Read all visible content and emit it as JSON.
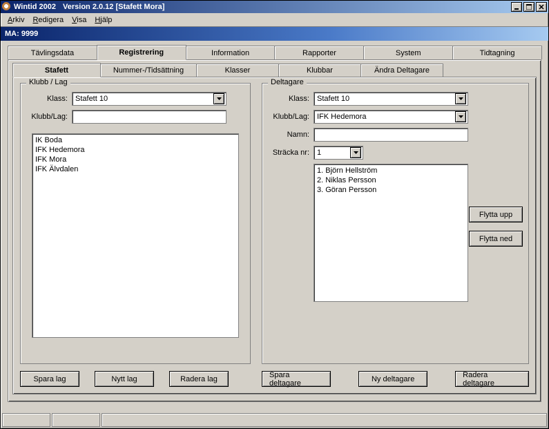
{
  "window": {
    "title_app": "Wintid 2002",
    "title_version": "Version 2.0.12 [Stafett Mora]"
  },
  "menu": {
    "arkiv": "Arkiv",
    "redigera": "Redigera",
    "visa": "Visa",
    "help": "Hjälp"
  },
  "infobar": {
    "text": "MA: 9999"
  },
  "main_tabs": {
    "tavlingsdata": "Tävlingsdata",
    "registrering": "Registrering",
    "information": "Information",
    "rapporter": "Rapporter",
    "system": "System",
    "tidtagning": "Tidtagning"
  },
  "sub_tabs": {
    "stafett": "Stafett",
    "nummer": "Nummer-/Tidsättning",
    "klasser": "Klasser",
    "klubbar": "Klubbar",
    "andra": "Ändra Deltagare"
  },
  "klubb_lag": {
    "legend": "Klubb / Lag",
    "klass_label": "Klass:",
    "klass_value": "Stafett 10",
    "klubblag_label": "Klubb/Lag:",
    "klubblag_value": "",
    "list": [
      "IK Boda",
      "IFK Hedemora",
      "IFK Mora",
      "IFK Älvdalen"
    ]
  },
  "deltagare": {
    "legend": "Deltagare",
    "klass_label": "Klass:",
    "klass_value": "Stafett 10",
    "klubblag_label": "Klubb/Lag:",
    "klubblag_value": "IFK Hedemora",
    "namn_label": "Namn:",
    "namn_value": "",
    "stracka_label": "Sträcka nr:",
    "stracka_value": "1",
    "list": [
      "1. Björn Hellström",
      "2. Niklas Persson",
      "3. Göran Persson"
    ]
  },
  "buttons": {
    "flytta_upp": "Flytta upp",
    "flytta_ned": "Flytta ned",
    "spara_lag": "Spara lag",
    "nytt_lag": "Nytt lag",
    "radera_lag": "Radera lag",
    "spara_deltagare": "Spara deltagare",
    "ny_deltagare": "Ny deltagare",
    "radera_deltagare": "Radera deltagare"
  }
}
